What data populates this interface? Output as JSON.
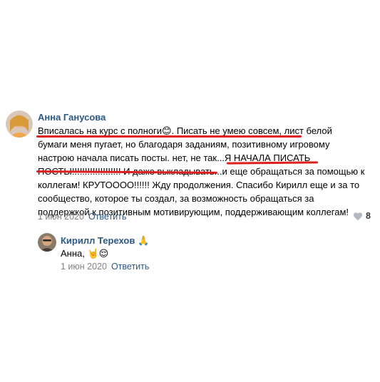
{
  "comment": {
    "author": "Анна Ганусова",
    "lines": [
      "Вписалась на курс с полноги😊. Писать не умею совсем, лист белой",
      "бумаги меня пугает, но благодаря заданиям, позитивному игровому",
      "настрою начала писать посты. нет, не так...Я НАЧАЛА ПИСАТЬ",
      "ПОСТЫ!!!!!!!!!!!!!!!!!!! И даже выкладывать...и еще обращаться за помощью к",
      "коллегам! КРУТОООО!!!!!! Жду продолжения. Спасибо Кирилл еще и за то",
      "сообщество, которое ты создал, за возможность обращаться за",
      "поддержкой к позитивным мотивирующим, поддерживающим коллегам!"
    ],
    "date": "1 июн 2020",
    "reply_label": "Ответить",
    "like_count": "8"
  },
  "reply": {
    "author": "Кирилл Терехов 🙏",
    "text": "Анна, 🤘😌",
    "date": "1 июн 2020",
    "reply_label": "Ответить"
  },
  "colors": {
    "link": "#2a5885",
    "meta": "#828282",
    "underline": "#e01d1d"
  }
}
